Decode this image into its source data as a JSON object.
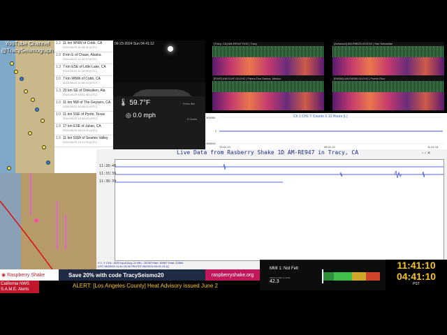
{
  "map_top": {
    "channel_label_line1": "YouTube Channel",
    "channel_label_line2": "@TracySeismograph"
  },
  "quake_list": [
    {
      "mag": "1.2",
      "place": "11 km WNW of Cobb, CA",
      "time": "2024-06-23 11:34:31 (UTC)"
    },
    {
      "mag": "1.9",
      "place": "8 km E of Chase, Alaska",
      "time": "2024-06-23 11:24:10 (UTC)"
    },
    {
      "mag": "1.3",
      "place": "7 km ESE of Little Lake, CA",
      "time": "2024-06-23 11:12:59 (UTC)"
    },
    {
      "mag": "1.0",
      "place": "7 km WNW of Cobb, CA",
      "time": "2024-06-23 11:06:19 (UTC)"
    },
    {
      "mag": "1.3",
      "place": "20 km SE of Olokuiken, Ala",
      "time": "2024-06-23 10:51:00 (UTC)"
    },
    {
      "mag": "1.0",
      "place": "11 km NW of The Geysers, CA",
      "time": "2024-06-23 10:48:13 (UTC)"
    },
    {
      "mag": "1.0",
      "place": "11 km SSE of Pyote, Texas",
      "time": "2024-06-23 10:38:03 (UTC)"
    },
    {
      "mag": "1.9",
      "place": "17 km ESE of Julian, CA",
      "time": "2024-06-23 10:23:10 (UTC)"
    },
    {
      "mag": "1.5",
      "place": "11 km SSW of Searles Valley",
      "time": "2024-06-23 10:11:34 (UTC)"
    }
  ],
  "camera": {
    "stamp": "06-23-2024 Sun 04:41:12"
  },
  "weather": {
    "temperature": "59.7°F",
    "wind_speed": "0.0 mph",
    "small_left": "Feels like",
    "small_right": "0 Gusts"
  },
  "spectrograms": [
    {
      "title": "[Tracy, CA] AM-RE947 EHZ | Tracy"
    },
    {
      "title": "[Ashwood] AM-R9B2D-00-EHZ | San Sebastian"
    },
    {
      "title": "[R14F] AM-R14F-00-EHZ | Palma Dos Santos, Mexico"
    },
    {
      "title": "[R4550] AM-R4550-00-EHZ | Puerto Rico"
    }
  ],
  "helicorder_small": {
    "title": "Ch 1 CH1 Y Counts X 12 Hours (L)",
    "y_labels": [
      "500000",
      "2",
      "-500000"
    ],
    "x_labels": [
      "23:41:13",
      "05:41:13",
      "11:41:13"
    ]
  },
  "helicorder_main": {
    "title": "Live Data from Rasberry Shake 1D AM-RE947 in Tracy, CA",
    "row_labels": [
      "11:28:40",
      "11:33:39",
      "11:38:39"
    ],
    "footer_line1": "X 1, Y CH1: 1500   Input Avg: 11   Min: -15782   Max: 16987   Total: 22864",
    "footer_line2": "UTC 06/23/24 11:41:13.39 PM  PDT 06/23/24 04:41:13 (L)"
  },
  "ad": {
    "logo": "Raspberry Shake",
    "text": "Save 20% with code TracySeismo20",
    "url": "raspberryshake.org"
  },
  "mmi": {
    "title": "MMI 1: Not Felt",
    "accel_label": "PEAK ACCEL (cm/s2)",
    "value": "42.3",
    "colors": [
      "#2f8f3a",
      "#3fbf4a",
      "#cfa52a",
      "#d0442a"
    ]
  },
  "clock": {
    "utc_time": "11:41:10",
    "local_time": "04:41:10",
    "timezone": "PST"
  },
  "alerts": {
    "source_line1": "California NWS",
    "source_line2": "S.A.M.E. Alerts",
    "text": "ALERT: [Los Angeles County] Heat Advisory issued June 2"
  }
}
